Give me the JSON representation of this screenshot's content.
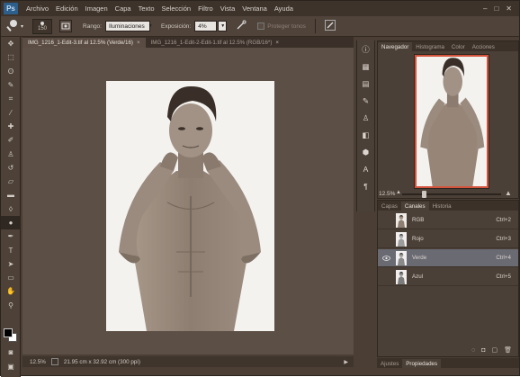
{
  "app": {
    "logo": "Ps"
  },
  "menu": [
    "Archivo",
    "Edición",
    "Imagen",
    "Capa",
    "Texto",
    "Selección",
    "Filtro",
    "Vista",
    "Ventana",
    "Ayuda"
  ],
  "window_controls": {
    "minimize": "–",
    "maximize": "□",
    "close": "✕"
  },
  "options": {
    "tool_icon": "dodge-tool-icon",
    "brush_size": "150",
    "range_label": "Rango:",
    "range_value": "Iluminaciones",
    "exposure_label": "Exposición:",
    "exposure_value": "4%",
    "protect_label": "Proteger tonos"
  },
  "toolbar_tools": [
    "move",
    "marquee",
    "lasso",
    "quick-select",
    "crop",
    "eyedropper",
    "healing",
    "brush",
    "clone-stamp",
    "history-brush",
    "eraser",
    "gradient",
    "blur",
    "dodge",
    "pen",
    "type",
    "path-select",
    "shape",
    "hand",
    "zoom"
  ],
  "doc_tabs": [
    {
      "label": "IMG_1216_1-Edit-3.tif al 12.5% (Verde/16)",
      "close": "×",
      "active": true
    },
    {
      "label": "IMG_1216_1-Edit-2-Edit-1.tif al 12.5% (RGB/16*)",
      "close": "×",
      "active": false
    }
  ],
  "status": {
    "zoom": "12.5%",
    "info": "21.95 cm x 32.92 cm (300 ppi)"
  },
  "nav_panel": {
    "tabs": [
      "Navegador",
      "Histograma",
      "Color",
      "Acciones"
    ],
    "zoom": "12.5%"
  },
  "channels_panel": {
    "tabs": [
      "Capas",
      "Canales",
      "Historia"
    ],
    "channels": [
      {
        "name": "RGB",
        "key": "Ctrl+2",
        "visible": false,
        "selected": false
      },
      {
        "name": "Rojo",
        "key": "Ctrl+3",
        "visible": false,
        "selected": false
      },
      {
        "name": "Verde",
        "key": "Ctrl+4",
        "visible": true,
        "selected": true
      },
      {
        "name": "Azul",
        "key": "Ctrl+5",
        "visible": false,
        "selected": false
      }
    ]
  },
  "adj_tabs": [
    "Ajustes",
    "Propiedades"
  ],
  "colors": {
    "accent_frame": "#d3533d",
    "selected_row": "#6a6a72"
  }
}
